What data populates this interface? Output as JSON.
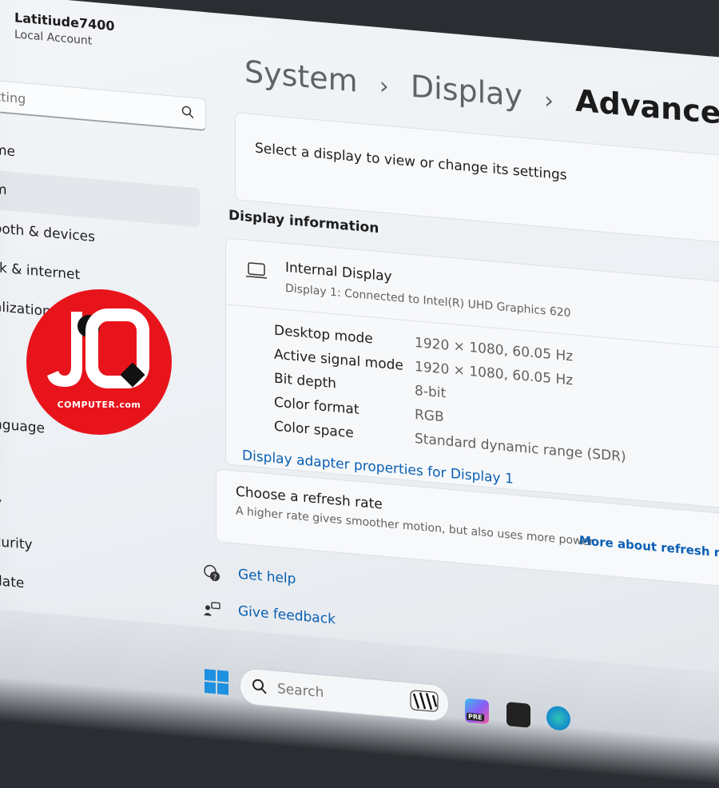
{
  "account": {
    "name": "Latitiude7400",
    "type": "Local Account"
  },
  "search": {
    "placeholder": "tting"
  },
  "nav": {
    "items": [
      {
        "label": "me"
      },
      {
        "label": "m"
      },
      {
        "label": "ooth & devices"
      },
      {
        "label": "rk & internet"
      },
      {
        "label": "alization"
      },
      {
        "label": ""
      },
      {
        "label": "s"
      },
      {
        "label": "nguage"
      },
      {
        "label": ""
      },
      {
        "label": "y"
      },
      {
        "label": "curity"
      },
      {
        "label": "date"
      }
    ]
  },
  "breadcrumb": {
    "level1": "System",
    "level2": "Display",
    "current": "Advanced displa"
  },
  "select_prompt": "Select a display to view or change its settings",
  "display_info": {
    "section_title": "Display information",
    "name": "Internal Display",
    "subtitle": "Display 1: Connected to Intel(R) UHD Graphics 620",
    "rows": [
      {
        "label": "Desktop mode",
        "value": "1920 × 1080, 60.05 Hz"
      },
      {
        "label": "Active signal mode",
        "value": "1920 × 1080, 60.05 Hz"
      },
      {
        "label": "Bit depth",
        "value": "8-bit"
      },
      {
        "label": "Color format",
        "value": "RGB"
      },
      {
        "label": "Color space",
        "value": "Standard dynamic range (SDR)"
      }
    ],
    "adapter_link": "Display adapter properties for Display 1"
  },
  "refresh": {
    "title": "Choose a refresh rate",
    "description": "A higher rate gives smoother motion, but also uses more power",
    "link": "More about refresh rate"
  },
  "help": {
    "get_help": "Get help",
    "give_feedback": "Give feedback"
  },
  "taskbar": {
    "search_placeholder": "Search",
    "copilot_badge": "PRE"
  },
  "watermark": {
    "letters": "JQ",
    "text": "COMPUTER.com"
  },
  "colors": {
    "link": "#0a5fb4",
    "logo_red": "#e8141b",
    "accent": "#0078d4"
  }
}
